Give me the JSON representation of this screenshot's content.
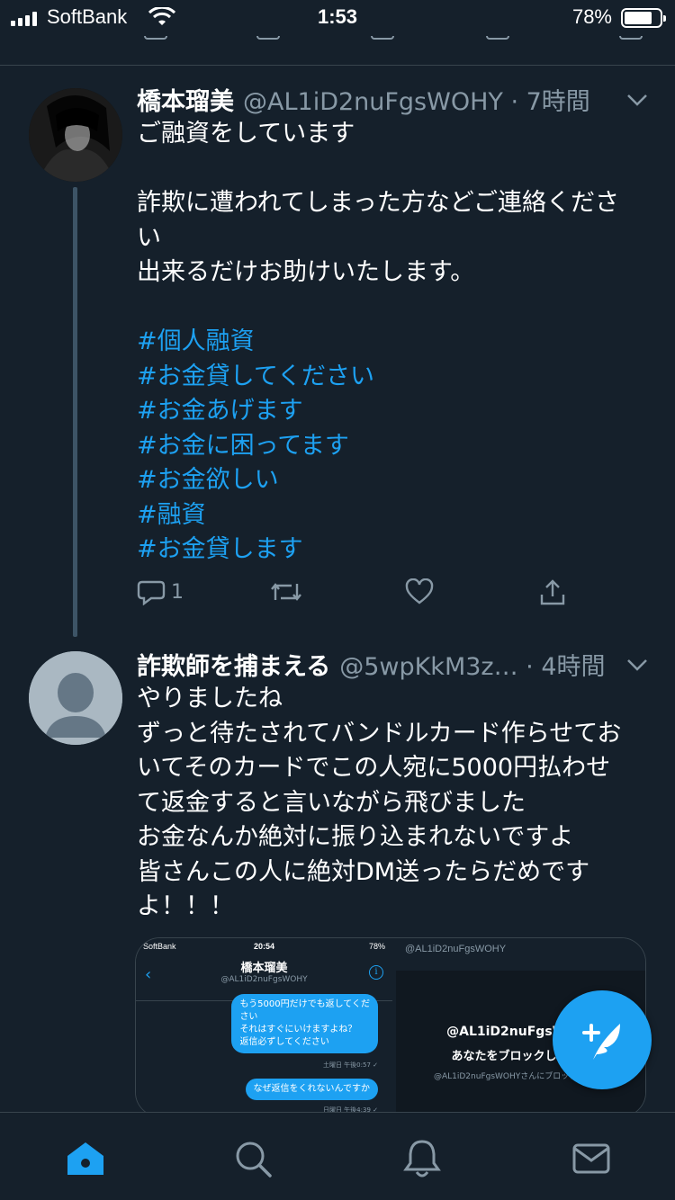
{
  "status_bar": {
    "carrier": "SoftBank",
    "time": "1:53",
    "battery_percent": "78%",
    "battery_level": 0.78
  },
  "tweets": [
    {
      "display_name": "橋本瑠美",
      "meta": "@AL1iD2nuFgsWOHY · 7時間",
      "avatar_icon": "photo-avatar",
      "lines": [
        "ご融資をしています",
        "",
        "詐欺に遭われてしまった方などご連絡くださ",
        "い",
        "出来るだけお助けいたします。",
        ""
      ],
      "hashtags": [
        "#個人融資",
        "#お金貸してください",
        "#お金あげます",
        "#お金に困ってます",
        "#お金欲しい",
        "#融資",
        "#お金貸します"
      ],
      "reply_count": "1"
    },
    {
      "display_name": "詐欺師を捕まえる",
      "meta": "@5wpKkM3z… · 4時間",
      "avatar_icon": "default-avatar",
      "lines": [
        "やりましたね",
        "ずっと待たされてバンドルカード作らせてお",
        "いてそのカードでこの人宛に5000円払わせ",
        "て返金すると言いながら飛びました",
        "お金なんか絶対に振り込まれないですよ",
        "皆さんこの人に絶対DM送ったらだめです",
        "よ！！！"
      ],
      "media": {
        "left": {
          "status_carrier": "SoftBank",
          "status_time": "20:54",
          "status_battery": "78%",
          "chat_name": "橋本瑠美",
          "chat_handle": "@AL1iD2nuFgsWOHY",
          "bubble1_lines": [
            "もう5000円だけでも返してくだ",
            "さい",
            "それはすぐにいけますよね？",
            "返信必ずしてください"
          ],
          "bubble1_time": "土曜日 午後0:57 ✓",
          "bubble2": "なぜ返信をくれないんですか",
          "bubble2_time": "日曜日 午後4:39 ✓"
        },
        "right": {
          "handle": "@AL1iD2nuFgsWOHY",
          "title": "@AL1iD2nuFgsWOHY",
          "subtitle": "あなたをブロックしました",
          "desc": "@AL1iD2nuFgsWOHYさんにブロックされてい"
        }
      }
    }
  ],
  "tab_bar": {
    "items": [
      "home-icon",
      "search-icon",
      "notifications-icon",
      "messages-icon"
    ],
    "active": "home-icon"
  },
  "colors": {
    "background": "#15202b",
    "accent": "#1da1f2",
    "muted": "#8899a6",
    "divider": "#38444d"
  }
}
